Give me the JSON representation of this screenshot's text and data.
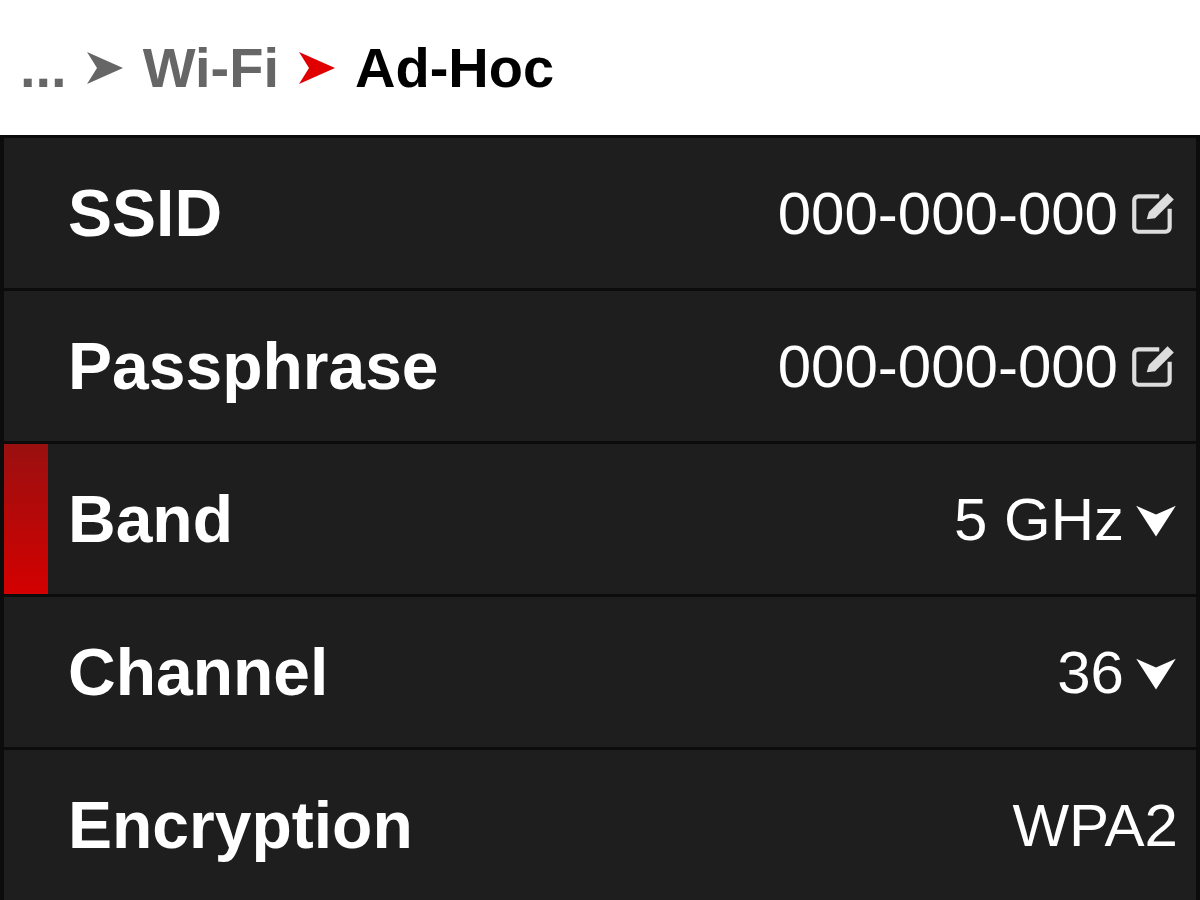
{
  "breadcrumb": [
    {
      "text": "...",
      "selected": false
    },
    {
      "text": "Wi-Fi",
      "selected": false
    },
    {
      "text": "Ad-Hoc",
      "selected": true
    }
  ],
  "rows": [
    {
      "label": "SSID",
      "value": "000-000-000",
      "kind": "edit",
      "selected": false
    },
    {
      "label": "Passphrase",
      "value": "000-000-000",
      "kind": "edit",
      "selected": false
    },
    {
      "label": "Band",
      "value": "5 GHz",
      "kind": "dropdown",
      "selected": true
    },
    {
      "label": "Channel",
      "value": "36",
      "kind": "dropdown",
      "selected": false
    },
    {
      "label": "Encryption",
      "value": "WPA2",
      "kind": "readonly",
      "selected": false
    }
  ]
}
